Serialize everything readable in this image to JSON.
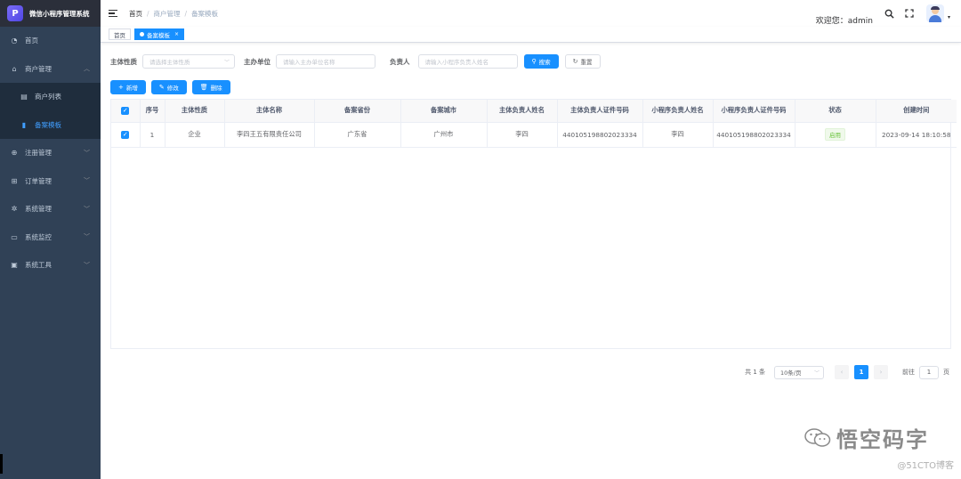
{
  "app": {
    "title": "微信小程序管理系统",
    "logo_glyph": "P"
  },
  "sidebar": {
    "items": [
      {
        "label": "首页",
        "icon": "dashboard-icon",
        "glyph": "◔"
      },
      {
        "label": "商户管理",
        "icon": "shop-icon",
        "glyph": "⌂",
        "chevron": "︿"
      },
      {
        "label": "商户列表",
        "icon": "list-icon",
        "glyph": "▤"
      },
      {
        "label": "备案模板",
        "icon": "template-icon",
        "glyph": "▮"
      },
      {
        "label": "注册管理",
        "icon": "register-icon",
        "glyph": "⊕",
        "chevron": "﹀"
      },
      {
        "label": "订单管理",
        "icon": "cart-icon",
        "glyph": "⊞",
        "chevron": "﹀"
      },
      {
        "label": "系统管理",
        "icon": "gear-icon",
        "glyph": "✲",
        "chevron": "﹀"
      },
      {
        "label": "系统监控",
        "icon": "monitor-icon",
        "glyph": "▭",
        "chevron": "﹀"
      },
      {
        "label": "系统工具",
        "icon": "toolbox-icon",
        "glyph": "▣",
        "chevron": "﹀"
      }
    ]
  },
  "navbar": {
    "breadcrumb": [
      "首页",
      "商户管理",
      "备案模板"
    ],
    "separator": "/",
    "welcome": "欢迎您：admin",
    "caret": "▾"
  },
  "tags": [
    {
      "label": "首页"
    },
    {
      "label": "备案模板",
      "close": "×"
    }
  ],
  "search": {
    "subject_type_label": "主体性质",
    "subject_type_placeholder": "请选择主体性质",
    "org_label": "主办单位",
    "org_placeholder": "请输入主办单位名称",
    "owner_label": "负责人",
    "owner_placeholder": "请输入小程序负责人姓名",
    "search_btn": "搜索",
    "reset_btn": "重置"
  },
  "toolbar": {
    "add": "新增",
    "edit": "修改",
    "delete": "删除"
  },
  "table": {
    "columns": [
      "序号",
      "主体性质",
      "主体名称",
      "备案省份",
      "备案城市",
      "主体负责人姓名",
      "主体负责人证件号码",
      "小程序负责人姓名",
      "小程序负责人证件号码",
      "状态",
      "创建时间"
    ],
    "rows": [
      [
        "1",
        "企业",
        "李四王五有限责任公司",
        "广东省",
        "广州市",
        "李四",
        "440105198802023334",
        "李四",
        "440105198802023334",
        "启用",
        "2023-09-14 18:10:58"
      ]
    ]
  },
  "pagination": {
    "total": "共 1 条",
    "page_size": "10条/页",
    "current": "1",
    "goto_label": "前往",
    "goto_value": "1",
    "page_suffix": "页",
    "prev": "‹",
    "next": "›"
  },
  "watermark": {
    "main": "悟空码字",
    "sub": "@51CTO博客"
  },
  "colors": {
    "sidebar": "#304156",
    "primary": "#1890ff",
    "active_menu": "#409eff"
  }
}
